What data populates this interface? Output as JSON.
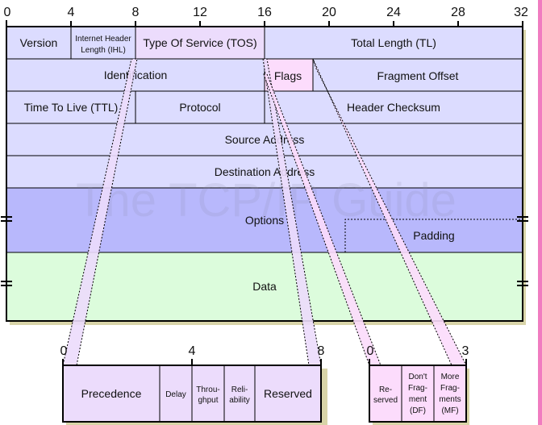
{
  "colors": {
    "header_field": "#dcdcff",
    "tos_field": "#ecdcfc",
    "flags_field": "#fcdcfc",
    "options_field": "#b8b8fc",
    "data_field": "#dcfcdc",
    "shadow": "#d8d4a8",
    "side_bar": "#f07cc0"
  },
  "watermark": "The TCP/IP Guide",
  "bit_ruler": [
    "0",
    "4",
    "8",
    "12",
    "16",
    "20",
    "24",
    "28",
    "32"
  ],
  "fields": {
    "version": "Version",
    "ihl_line1": "Internet Header",
    "ihl_line2": "Length (IHL)",
    "tos": "Type Of Service (TOS)",
    "total_length": "Total Length (TL)",
    "identification": "Identification",
    "flags": "Flags",
    "fragment_offset": "Fragment Offset",
    "ttl": "Time To Live (TTL)",
    "protocol": "Protocol",
    "header_checksum": "Header Checksum",
    "source_address": "Source Address",
    "destination_address": "Destination Address",
    "options": "Options",
    "padding": "Padding",
    "data": "Data"
  },
  "tos_detail": {
    "ruler": [
      "0",
      "4",
      "8"
    ],
    "precedence": "Precedence",
    "delay": "Delay",
    "throughput_1": "Throu-",
    "throughput_2": "ghput",
    "reliability_1": "Reli-",
    "reliability_2": "ability",
    "reserved": "Reserved"
  },
  "flags_detail": {
    "ruler": [
      "0",
      "3"
    ],
    "reserved_1": "Re-",
    "reserved_2": "served",
    "df_1": "Don't",
    "df_2": "Frag-",
    "df_3": "ment",
    "df_4": "(DF)",
    "mf_1": "More",
    "mf_2": "Frag-",
    "mf_3": "ments",
    "mf_4": "(MF)"
  }
}
